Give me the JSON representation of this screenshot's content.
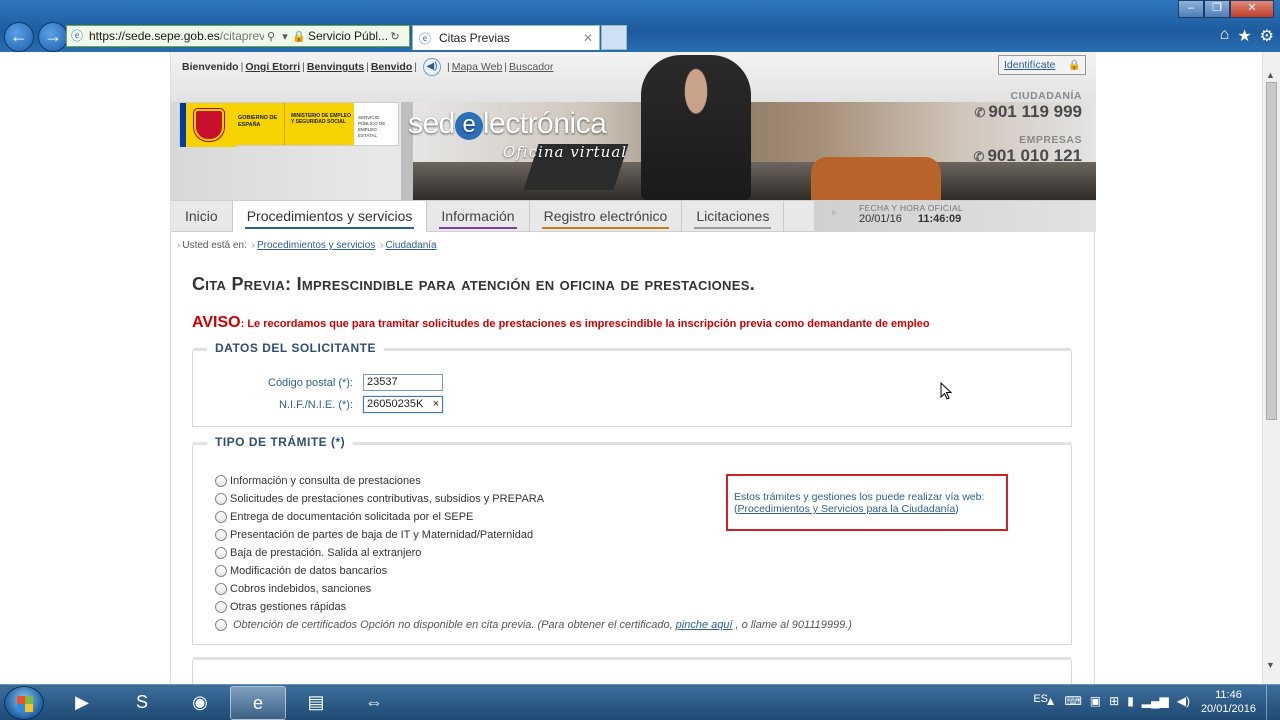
{
  "browser": {
    "url_highlight": "https://sede.sepe.gob.es",
    "url_rest": "/citaprevia",
    "site_label": "Servicio Públ...",
    "tab_title": "Citas Previas",
    "back_icon": "back-arrow-icon",
    "forward_icon": "forward-arrow-icon"
  },
  "topnav": {
    "bienvenido": "Bienvenido",
    "langs": [
      "Ongi Etorri",
      "Benvinguts",
      "Benvido"
    ],
    "mapa": "Mapa Web",
    "buscador": "Buscador",
    "identificate": "Identifícate"
  },
  "logos": {
    "gobierno": "GOBIERNO DE ESPAÑA",
    "ministerio": "MINISTERIO DE EMPLEO Y SEGURIDAD SOCIAL",
    "sepe": "SERVICIO PÚBLICO DE EMPLEO ESTATAL"
  },
  "brand": {
    "pre": "sed",
    "e": "e",
    "post": "lectrónica",
    "tagline": "Oficina virtual"
  },
  "phones": {
    "ciudadania_label": "CIUDADANÍA",
    "ciudadania_num": "901 119 999",
    "empresas_label": "EMPRESAS",
    "empresas_num": "901 010 121"
  },
  "nav": {
    "tabs": [
      {
        "label": "Inicio",
        "color": ""
      },
      {
        "label": "Procedimientos y servicios",
        "color": "#2c5f8e"
      },
      {
        "label": "Información",
        "color": "#7b3f91"
      },
      {
        "label": "Registro electrónico",
        "color": "#c77a1e"
      },
      {
        "label": "Licitaciones",
        "color": "#999999"
      }
    ],
    "datetime_label": "FECHA Y HORA OFICIAL",
    "date": "20/01/16",
    "time": "11:46:09"
  },
  "breadcrumb": {
    "prefix": "Usted está en:",
    "items": [
      "Procedimientos y servicios",
      "Ciudadanía"
    ]
  },
  "title": "Cita Previa: Imprescindible para atención en oficina de prestaciones.",
  "aviso": {
    "label": "AVISO",
    "text": ": Le recordamos que para tramitar solicitudes de prestaciones es imprescindible la inscripción previa como demandante de empleo"
  },
  "solicitante": {
    "legend": "DATOS DEL SOLICITANTE",
    "cp_label": "Código postal (*):",
    "cp_value": "23537",
    "nif_label": "N.I.F./N.I.E. (*):",
    "nif_value": "26050235K",
    "nif_clear": "×"
  },
  "tramite": {
    "legend": "TIPO DE TRÁMITE (*)",
    "options": [
      "Información y consulta de prestaciones",
      "Solicitudes de prestaciones contributivas, subsidios y PREPARA",
      "Entrega de documentación solicitada por el SEPE",
      "Presentación de partes de baja de IT y Maternidad/Paternidad",
      "Baja de prestación. Salida al extranjero",
      "Modificación de datos bancarios",
      "Cobros indebidos, sanciones",
      "Otras gestiones rápidas"
    ],
    "disabled_pre": "Obtención de certificados Opción no disponible en cita previa. (Para obtener el certificado,",
    "disabled_link": "pinche aquí",
    "disabled_post": ", o llame al 901119999.)"
  },
  "infobox": {
    "text": "Estos trámites y gestiones los puede realizar vía web:",
    "open": "(",
    "link": "Procedimientos y Servicios para la Ciudadanía",
    "close": ")"
  },
  "taskbar": {
    "lang": "ES",
    "time": "11:46",
    "date": "20/01/2016"
  }
}
